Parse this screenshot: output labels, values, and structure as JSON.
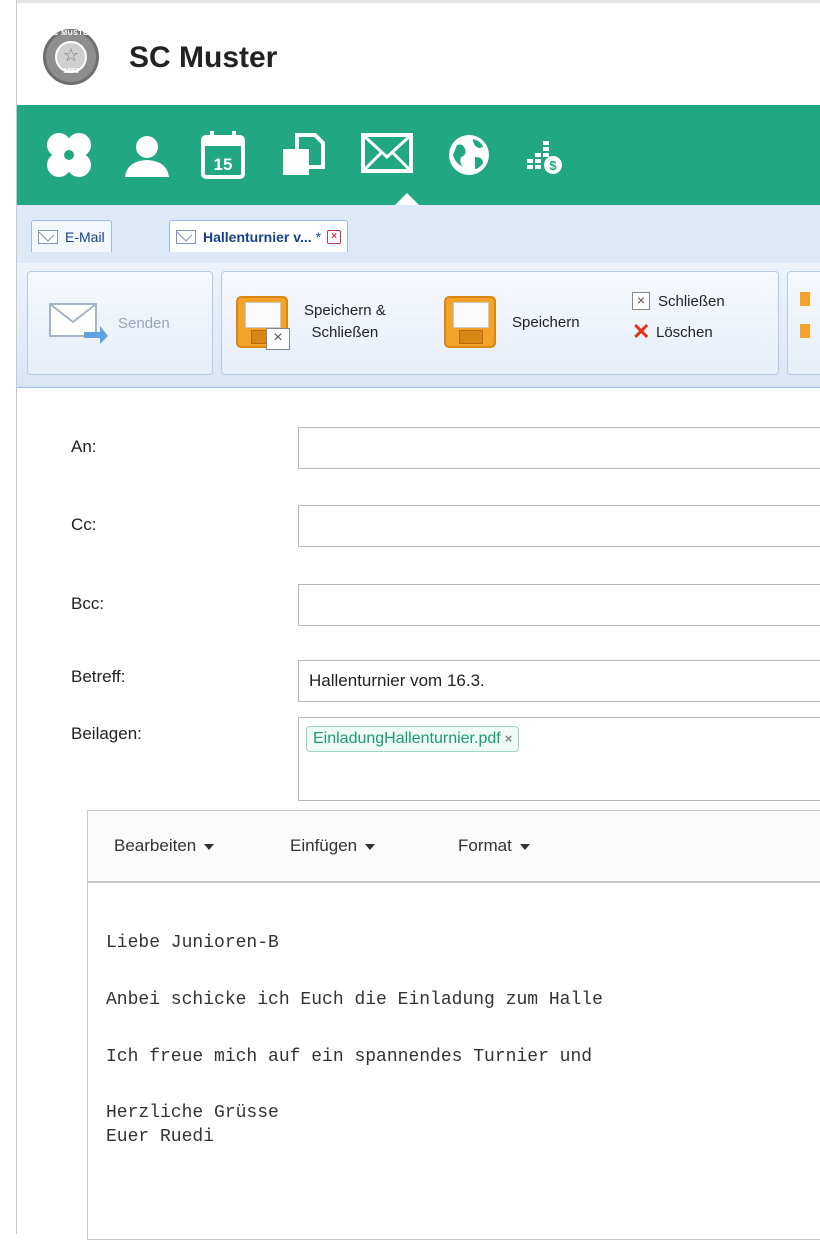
{
  "app": {
    "title": "SC Muster",
    "logo_text": "SC MUSTER",
    "logo_year": "1893"
  },
  "nav": {
    "icons": [
      "clover-icon",
      "user-icon",
      "calendar-icon",
      "documents-icon",
      "mail-icon",
      "globe-icon",
      "finance-icon"
    ],
    "calendar_day": "15",
    "active": "mail-icon",
    "accent": "#22a783"
  },
  "tabs": [
    {
      "label": "E-Mail",
      "active": false
    },
    {
      "label": "Hallenturnier v...",
      "modified": "*",
      "active": true
    }
  ],
  "toolbar": {
    "send_label": "Senden",
    "save_close_label_1": "Speichern &",
    "save_close_label_2": "Schließen",
    "save_label": "Speichern",
    "close_label": "Schließen",
    "delete_label": "Löschen"
  },
  "form": {
    "to_label": "An:",
    "to_value": "",
    "cc_label": "Cc:",
    "cc_value": "",
    "bcc_label": "Bcc:",
    "bcc_value": "",
    "subject_label": "Betreff:",
    "subject_value": "Hallenturnier vom 16.3.",
    "attachments_label": "Beilagen:",
    "attachments": [
      "EinladungHallenturnier.pdf"
    ]
  },
  "editor": {
    "menu": [
      "Bearbeiten",
      "Einfügen",
      "Format"
    ],
    "lines": [
      "Liebe Junioren-B",
      "Anbei schicke ich Euch die Einladung zum Halle",
      "Ich freue mich auf ein spannendes Turnier und",
      "Herzliche Grüsse",
      "Euer Ruedi"
    ]
  }
}
